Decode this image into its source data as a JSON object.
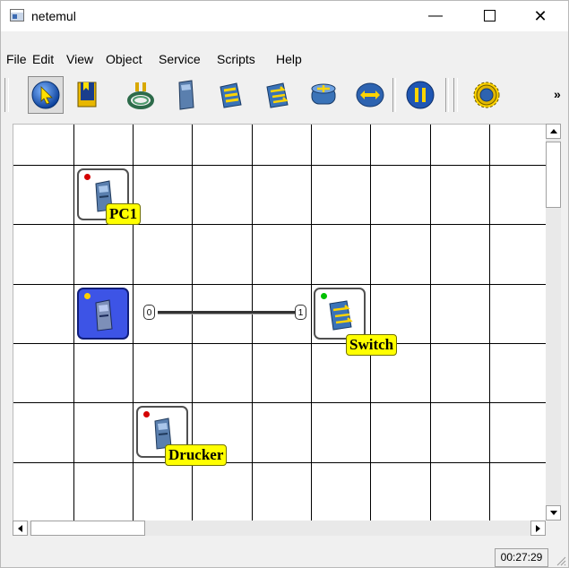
{
  "window": {
    "title": "netemul",
    "minimize_glyph": "—",
    "close_glyph": "✕"
  },
  "menu": [
    "File",
    "Edit",
    "View",
    "Object",
    "Service",
    "Scripts",
    "Help"
  ],
  "toolbar": {
    "tools": [
      {
        "name": "select-tool-icon",
        "active": true
      },
      {
        "name": "notepad-tool-icon"
      },
      {
        "name": "cable-tool-icon"
      },
      {
        "name": "computer-tool-icon"
      },
      {
        "name": "hub-tool-icon"
      },
      {
        "name": "switch-tool-icon"
      },
      {
        "name": "router-tool-icon"
      },
      {
        "name": "send-tool-icon"
      },
      {
        "name": "pause-icon"
      },
      {
        "name": "settings-gear-icon"
      }
    ],
    "overflow": "»"
  },
  "devices": {
    "pc1": {
      "label": "PC1",
      "status_color": "#d40000"
    },
    "computer": {
      "label": "",
      "status_color": "#ffd000",
      "selected": true
    },
    "switch": {
      "label": "Switch",
      "status_color": "#00c000"
    },
    "printer": {
      "label": "Drucker",
      "status_color": "#d40000"
    }
  },
  "cable": {
    "port_a": "0",
    "port_b": "1"
  },
  "status": {
    "clock": "00:27:29"
  }
}
